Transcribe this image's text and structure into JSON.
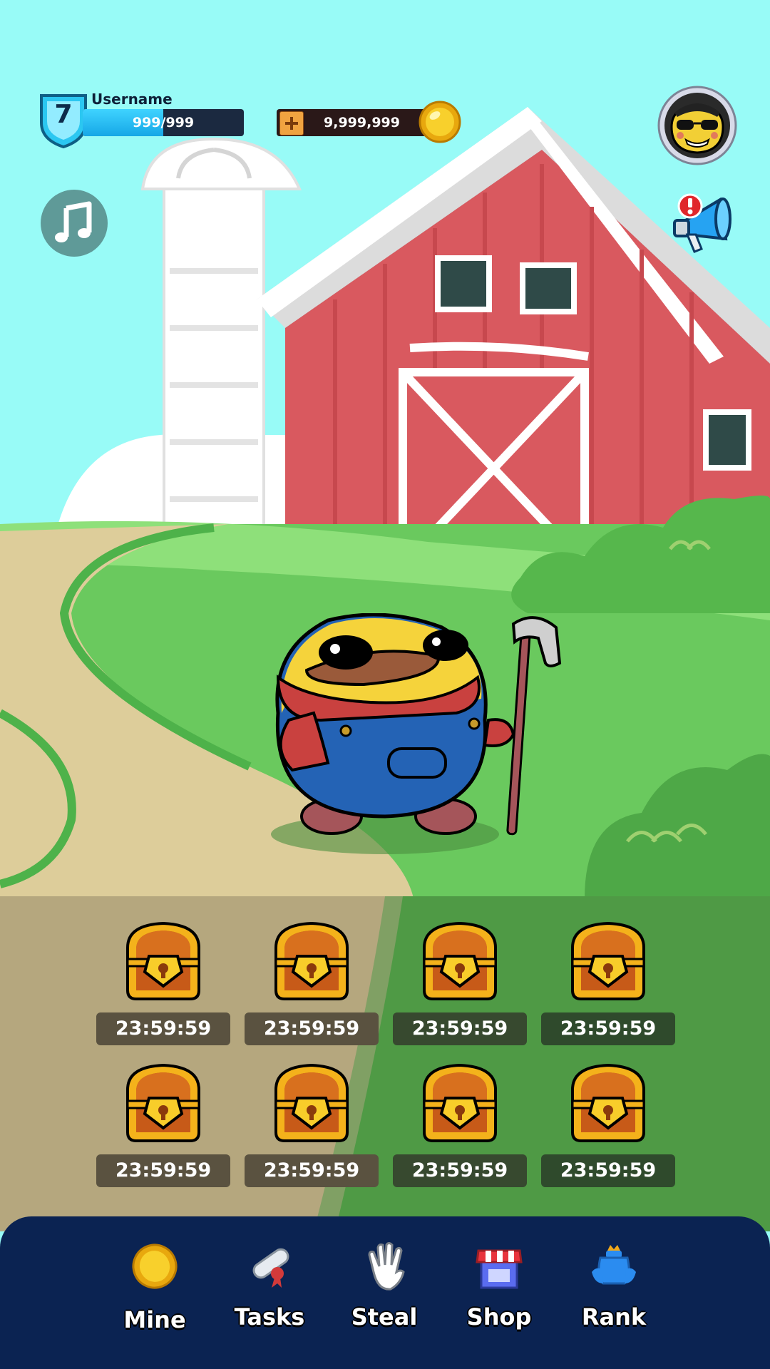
{
  "header": {
    "level": "7",
    "username": "Username",
    "xp_text": "999/999",
    "xp_fraction": 0.5,
    "coins": "9,999,999"
  },
  "icons": {
    "level": "shield-icon",
    "add_coins": "plus-icon",
    "coin": "coin-icon",
    "avatar": "sunglasses-face-icon",
    "music": "music-note-icon",
    "announcements": "megaphone-icon",
    "alert": "exclamation-icon"
  },
  "chests": [
    {
      "timer": "23:59:59"
    },
    {
      "timer": "23:59:59"
    },
    {
      "timer": "23:59:59"
    },
    {
      "timer": "23:59:59"
    },
    {
      "timer": "23:59:59"
    },
    {
      "timer": "23:59:59"
    },
    {
      "timer": "23:59:59"
    },
    {
      "timer": "23:59:59"
    }
  ],
  "nav": [
    {
      "label": "Mine",
      "icon": "coin-icon"
    },
    {
      "label": "Tasks",
      "icon": "scroll-icon"
    },
    {
      "label": "Steal",
      "icon": "glove-icon"
    },
    {
      "label": "Shop",
      "icon": "store-icon"
    },
    {
      "label": "Rank",
      "icon": "trophy-icon"
    }
  ],
  "colors": {
    "sky": "#98fbf7",
    "nav_bg": "#0b2352",
    "xp_fill": "#16a7e6",
    "barn_red": "#d9595f",
    "grass": "#6ac95e"
  }
}
